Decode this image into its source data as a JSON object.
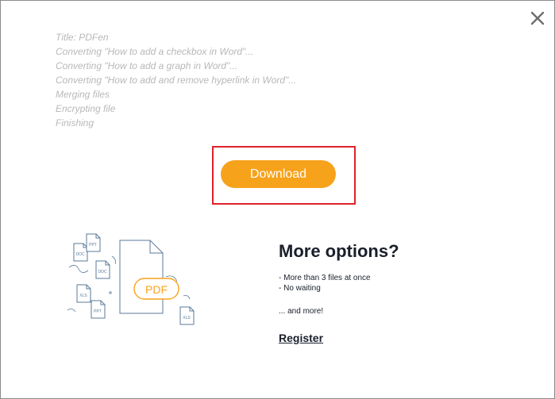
{
  "close": {
    "icon": "close-icon"
  },
  "log": [
    "Title: PDFen",
    "Converting \"How to add a checkbox in Word\"...",
    "Converting \"How to add a graph in Word\"...",
    "Converting \"How to add and remove hyperlink in Word\"...",
    "Merging files",
    "Encrypting file",
    "Finishing"
  ],
  "download": {
    "label": "Download",
    "color": "#f7a21b"
  },
  "illustration": {
    "icon": "documents-to-pdf-icon",
    "badge": "PDF",
    "small_labels": [
      "DOC",
      "PPT",
      "DOC",
      "XLS",
      "PPT",
      "XLS"
    ]
  },
  "options": {
    "title": "More options?",
    "items": [
      "-  More than 3 files at once",
      "-  No waiting"
    ],
    "more": "... and more!",
    "register": "Register"
  }
}
